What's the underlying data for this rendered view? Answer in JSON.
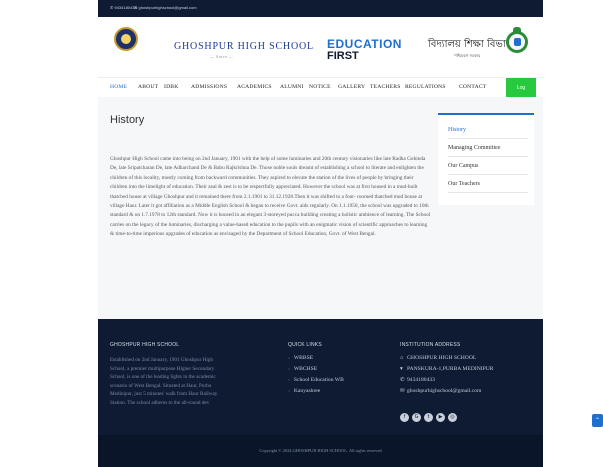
{
  "topbar": {
    "phone": "✆ 9434180433",
    "email": "✉ ghoshpurhighschool@gmail.com"
  },
  "header": {
    "school_name": "GHOSHPUR HIGH SCHOOL",
    "since": "— Since —",
    "edu_line1": "EDUCATION",
    "edu_line2": "FIRST",
    "bengali_title": "বিদ্যালয় শিক্ষা বিভাগ",
    "bengali_sub": "পশ্চিমবঙ্গ সরকার"
  },
  "nav": {
    "items": [
      "HOME",
      "ABOUT",
      "IDBK",
      "ADMISSIONS",
      "ACADEMICS",
      "ALUMNI",
      "NOTICE",
      "GALLERY",
      "TEACHERS",
      "REGULATIONS",
      "CONTACT"
    ],
    "login": "Log"
  },
  "page": {
    "title": "History",
    "body": "Ghoshpur High School came into being on 2nd January, 1901 with the help of some luminaries and 20th century visionaries like late Radha Gobinda De, late Sripatcharan De, late Adharchand De & Babu Rajkrishna De. Those noble souls dreamt of establishing a school to literate and enlighten the children of this locality, mostly coming from backward communities. They aspired to elevate the station of the lives of people by bringing their children into the limelight of education. Their zeal & zest is to be respectfully appreciated. However the school was at first housed in a mud-built thatched house at village Ghoshpur and it remained there from 2.1.1901 to 31.12.1928.Then it was shifted to a four- roomed thatched mud house at village Haur. Later it got affiliation as a Middle English School & began to receive Govt. aids regularly. On 1.1.1950, the school was upgraded to 10th standard & on 1.7.1978 to 12th standard. Now it is housed in an elegant 3-storeyed pucca building creating a holistic ambience of learning. The School carries on the legacy of the luminaries, discharging a value-based education to the pupils with an enigmatic vision of scientific approaches to learning & time-to-time imperious upgrades of education as envisaged by the Department of School Education, Govt. of West Bengal."
  },
  "side_menu": [
    "History",
    "Managing Committee",
    "Our Campus",
    "Our Teachers"
  ],
  "footer": {
    "about_heading": "GHOSHPUR HIGH SCHOOL",
    "about_text": "Established on 2nd January, 1901 Ghoshpur High School, a premier multipurpose Higher Secondary School, is one of the leading lights in the academic scenario of West Bengal. Situated at Haur, Purba Medinipur, just 5 minutes' walk from Haur Railway Station. The school adheres to the all-round dev",
    "links_heading": "QUICK LINKS",
    "links": [
      "WBBSE",
      "WBCHSE",
      "School Education WB",
      "Kanyashree"
    ],
    "address_heading": "INSTITUTION ADDRESS",
    "address": [
      {
        "icon": "building-icon",
        "glyph": "⌂",
        "text": "GHOSHPUR HIGH SCHOOL"
      },
      {
        "icon": "location-icon",
        "glyph": "▾",
        "text": "PANSKURA-1,PURBA MEDINIPUR"
      },
      {
        "icon": "phone-icon",
        "glyph": "✆",
        "text": "9434180433"
      },
      {
        "icon": "mail-icon",
        "glyph": "✉",
        "text": "ghoshpurhighschool@gmail.com"
      }
    ],
    "social": [
      {
        "name": "facebook-icon",
        "glyph": "f"
      },
      {
        "name": "google-plus-icon",
        "glyph": "G"
      },
      {
        "name": "twitter-icon",
        "glyph": "t"
      },
      {
        "name": "youtube-icon",
        "glyph": "▶"
      },
      {
        "name": "instagram-icon",
        "glyph": "◎"
      }
    ],
    "copyright": "Copyright © 2024,GHOSHPUR HIGH SCHOOL. All rights reserved"
  },
  "colors": {
    "navy": "#0e1b33",
    "accent_blue": "#1f6fd0",
    "login_green": "#27c93f"
  }
}
